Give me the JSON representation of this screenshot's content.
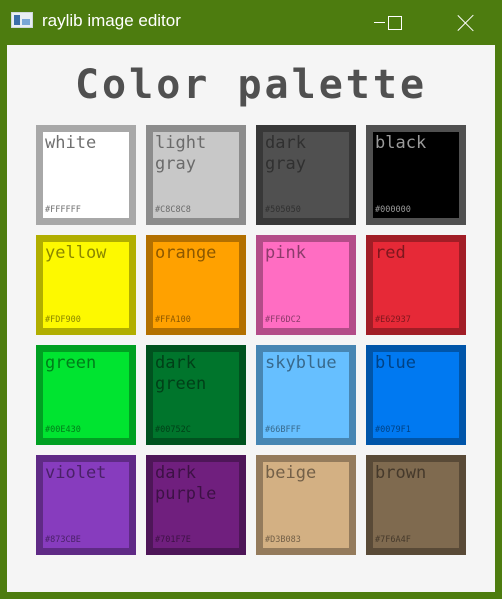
{
  "window": {
    "title": "raylib image editor",
    "icon": "app-icon",
    "controls": [
      "minimize-icon",
      "maximize-icon",
      "close-icon"
    ],
    "titlebar_color": "#4d7c0f"
  },
  "heading": "Color palette",
  "colors": [
    {
      "name": "white",
      "hex": "#FFFFFF",
      "fill": "#ffffff",
      "border": "#a8a8a8",
      "text": "#707070"
    },
    {
      "name": "light\ngray",
      "hex": "#C8C8C8",
      "fill": "#c8c8c8",
      "border": "#8c8c8c",
      "text": "#6a6a6a"
    },
    {
      "name": "dark\ngray",
      "hex": "#505050",
      "fill": "#505050",
      "border": "#383838",
      "text": "#303030"
    },
    {
      "name": "black",
      "hex": "#000000",
      "fill": "#000000",
      "border": "#505050",
      "text": "#9a9a9a"
    },
    {
      "name": "yellow",
      "hex": "#FDF900",
      "fill": "#fdf900",
      "border": "#b1ae00",
      "text": "#8a8700"
    },
    {
      "name": "orange",
      "hex": "#FFA100",
      "fill": "#ffa100",
      "border": "#b37000",
      "text": "#8c5800"
    },
    {
      "name": "pink",
      "hex": "#FF6DC2",
      "fill": "#ff6dc2",
      "border": "#b34c88",
      "text": "#8c3b6b"
    },
    {
      "name": "red",
      "hex": "#E62937",
      "fill": "#e62937",
      "border": "#a11d26",
      "text": "#7e171e"
    },
    {
      "name": "green",
      "hex": "#00E430",
      "fill": "#00e430",
      "border": "#00a022",
      "text": "#007d1a"
    },
    {
      "name": "dark\ngreen",
      "hex": "#00752C",
      "fill": "#00752c",
      "border": "#00521f",
      "text": "#004018"
    },
    {
      "name": "skyblue",
      "hex": "#66BFFF",
      "fill": "#66bfff",
      "border": "#4786b3",
      "text": "#38698c"
    },
    {
      "name": "blue",
      "hex": "#0079F1",
      "fill": "#0079f1",
      "border": "#0055a9",
      "text": "#004285"
    },
    {
      "name": "violet",
      "hex": "#873CBE",
      "fill": "#873cbe",
      "border": "#5f2a85",
      "text": "#4a2168"
    },
    {
      "name": "dark\npurple",
      "hex": "#701F7E",
      "fill": "#701f7e",
      "border": "#4e1658",
      "text": "#3d1145"
    },
    {
      "name": "beige",
      "hex": "#D3B083",
      "fill": "#d3b083",
      "border": "#947b5c",
      "text": "#736048"
    },
    {
      "name": "brown",
      "hex": "#7F6A4F",
      "fill": "#7f6a4f",
      "border": "#594a37",
      "text": "#45392b"
    }
  ]
}
